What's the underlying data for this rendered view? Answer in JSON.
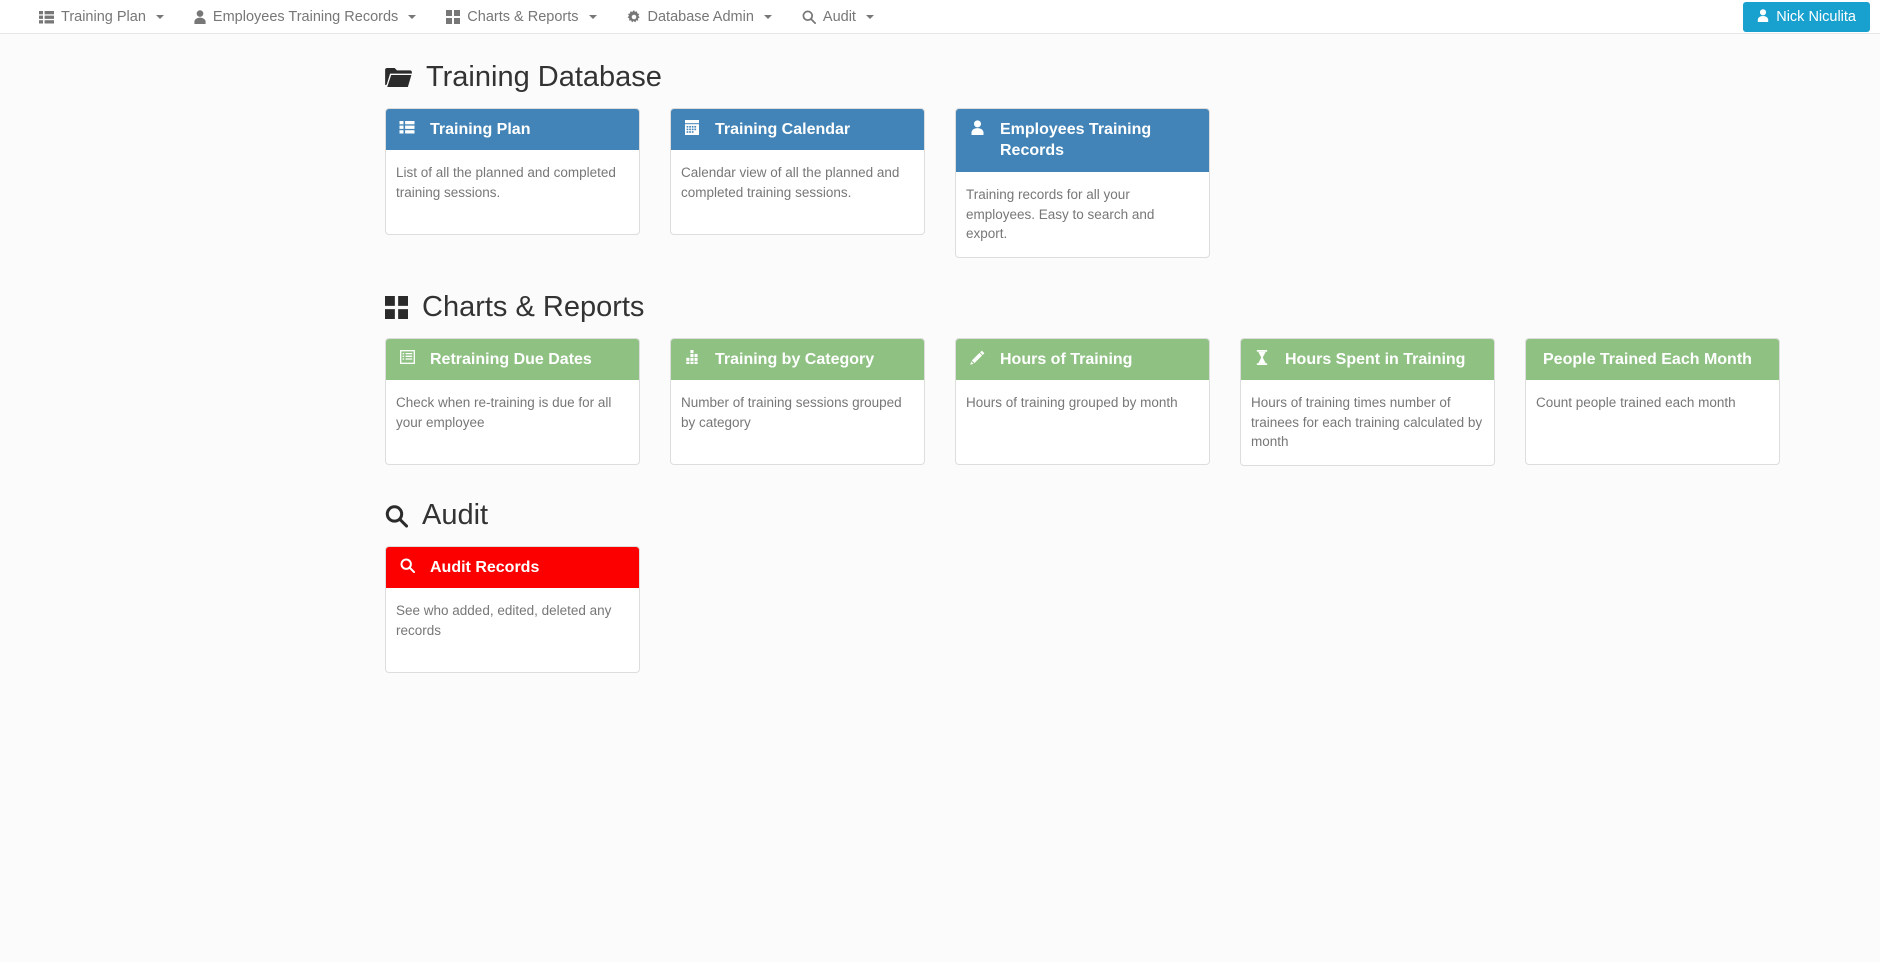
{
  "navbar": {
    "items": [
      {
        "label": "Training Plan",
        "icon": "list-icon",
        "caret": true
      },
      {
        "label": "Employees Training Records",
        "icon": "user-icon",
        "caret": true
      },
      {
        "label": "Charts & Reports",
        "icon": "grid-icon",
        "caret": true
      },
      {
        "label": "Database Admin",
        "icon": "gear-icon",
        "caret": true
      },
      {
        "label": "Audit",
        "icon": "search-icon",
        "caret": true
      }
    ],
    "user": {
      "name": "Nick Niculita",
      "icon": "user-icon",
      "color": "#18a0cf"
    }
  },
  "sections": [
    {
      "title": "Training Database",
      "icon": "folder-icon",
      "header_color": "#4284b7",
      "cards": [
        {
          "title": "Training Plan",
          "icon": "list-icon",
          "description": "List of all the planned and completed training sessions."
        },
        {
          "title": "Training Calendar",
          "icon": "calendar-icon",
          "description": "Calendar view of all the planned and completed training sessions."
        },
        {
          "title": "Employees Training Records",
          "icon": "user-icon",
          "description": "Training records for all your employees. Easy to search and export."
        }
      ]
    },
    {
      "title": "Charts & Reports",
      "icon": "grid-icon",
      "header_color": "#8fc183",
      "cards": [
        {
          "title": "Retraining Due Dates",
          "icon": "list-alt-icon",
          "description": "Check when re-training is due for all your employee"
        },
        {
          "title": "Training by Category",
          "icon": "bar-chart-icon",
          "description": "Number of training sessions grouped by category"
        },
        {
          "title": "Hours of Training",
          "icon": "pencil-icon",
          "description": "Hours of training grouped by month"
        },
        {
          "title": "Hours Spent in Training",
          "icon": "hourglass-icon",
          "description": "Hours of training times number of trainees for each training calculated by month"
        },
        {
          "title": "People Trained Each Month",
          "icon": "",
          "description": "Count people trained each month"
        }
      ]
    },
    {
      "title": "Audit",
      "icon": "search-icon",
      "header_color": "#fc0000",
      "cards": [
        {
          "title": "Audit Records",
          "icon": "search-icon",
          "description": "See who added, edited, deleted any records"
        }
      ]
    }
  ]
}
